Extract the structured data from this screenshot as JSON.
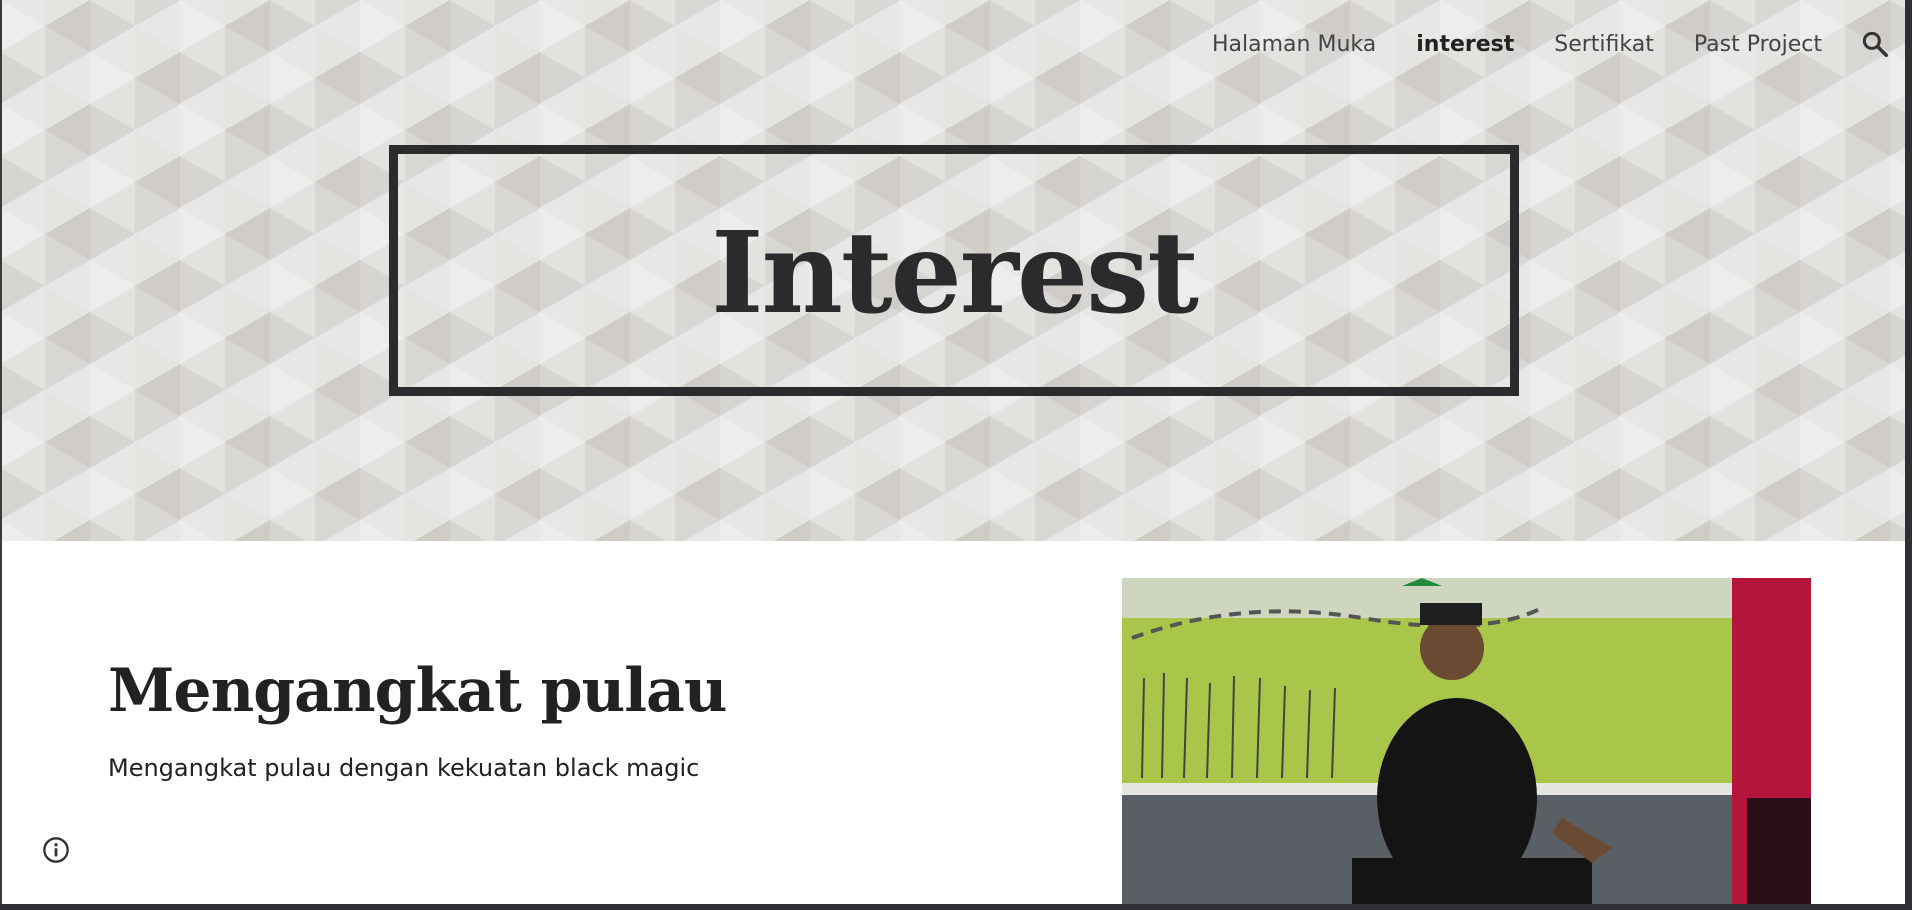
{
  "nav": {
    "items": [
      {
        "label": "Halaman Muka",
        "active": false
      },
      {
        "label": "interest",
        "active": true
      },
      {
        "label": "Sertifikat",
        "active": false
      },
      {
        "label": "Past Project",
        "active": false
      }
    ],
    "search_icon": "search-icon"
  },
  "hero": {
    "title": "Interest"
  },
  "content": {
    "heading": "Mengangkat pulau",
    "text": "Mengangkat pulau dengan kekuatan black magic"
  },
  "footer": {
    "info_icon": "info-icon"
  },
  "colors": {
    "title": "#2b2b2e",
    "text": "#222222",
    "photo_wall": "#a9c64a"
  }
}
